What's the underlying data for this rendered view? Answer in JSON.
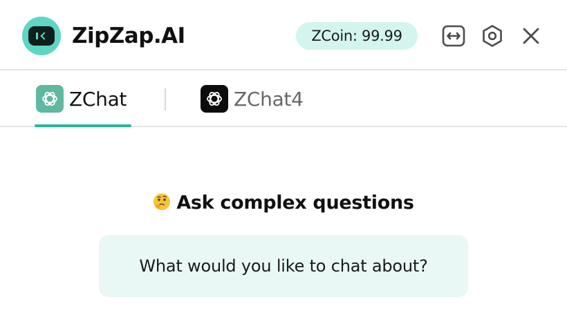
{
  "header": {
    "title": "ZipZap.AI",
    "logo_icon": "robot-face-icon",
    "coin_label": "ZCoin: 99.99",
    "actions": [
      {
        "name": "expand",
        "icon": "expand-arrows-icon"
      },
      {
        "name": "settings",
        "icon": "hexagon-settings-icon"
      },
      {
        "name": "close",
        "icon": "close-icon"
      }
    ]
  },
  "tabs": [
    {
      "label": "ZChat",
      "icon": "openai-logo-icon",
      "icon_bg": "#5fb8a0",
      "active": true
    },
    {
      "label": "ZChat4",
      "icon": "openai-logo-icon",
      "icon_bg": "#0c0c0c",
      "active": false
    }
  ],
  "main": {
    "emoji_icon": "thinking-face-icon",
    "heading": "Ask complex questions",
    "prompt": "What would you like to chat about?"
  },
  "colors": {
    "accent": "#25b99a",
    "badge_bg": "#d3f5ee",
    "card_bg": "#e9f7f5",
    "logo_bg": "#5fd6c3"
  }
}
